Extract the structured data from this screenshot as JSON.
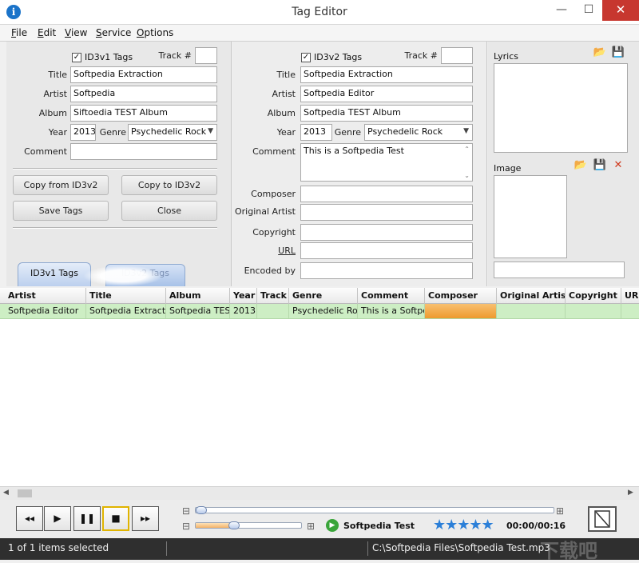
{
  "window": {
    "title": "Tag Editor",
    "minimize": "—",
    "maximize": "☐",
    "close": "✕"
  },
  "menu": [
    "File",
    "Edit",
    "View",
    "Service",
    "Options"
  ],
  "id3v1": {
    "checkbox_label": "ID3v1 Tags",
    "checked": "✓",
    "track_label": "Track #",
    "track_value": "",
    "title_label": "Title",
    "title_value": "Softpedia Extraction",
    "artist_label": "Artist",
    "artist_value": "Softpedia",
    "album_label": "Album",
    "album_value": "Siftoedia TEST Album",
    "year_label": "Year",
    "year_value": "2013",
    "genre_label": "Genre",
    "genre_value": "Psychedelic Rock",
    "comment_label": "Comment",
    "comment_value": "",
    "copy_from_label": "Copy from ID3v2",
    "copy_to_label": "Copy to ID3v2",
    "save_label": "Save Tags",
    "close_label": "Close"
  },
  "tabs": {
    "active": "ID3v1 Tags",
    "inactive": "ID3v2 Tags"
  },
  "id3v2": {
    "checkbox_label": "ID3v2 Tags",
    "checked": "✓",
    "track_label": "Track #",
    "track_value": "",
    "title_label": "Title",
    "title_value": "Softpedia Extraction",
    "artist_label": "Artist",
    "artist_value": "Softpedia Editor",
    "album_label": "Album",
    "album_value": "Softpedia TEST Album",
    "year_label": "Year",
    "year_value": "2013",
    "genre_label": "Genre",
    "genre_value": "Psychedelic Rock",
    "comment_label": "Comment",
    "comment_value": "This is a Softpedia Test",
    "composer_label": "Composer",
    "composer_value": "",
    "original_artist_label": "Original Artist",
    "original_artist_value": "",
    "copyright_label": "Copyright",
    "copyright_value": "",
    "url_label": "URL",
    "url_value": "",
    "encoded_by_label": "Encoded by",
    "encoded_by_value": ""
  },
  "side": {
    "lyrics_label": "Lyrics",
    "image_label": "Image",
    "image_caption": ""
  },
  "grid": {
    "columns": [
      "Artist",
      "Title",
      "Album",
      "Year",
      "Track",
      "Genre",
      "Comment",
      "Composer",
      "Original Artist",
      "Copyright",
      "URL"
    ],
    "rows": [
      [
        "Softpedia Editor",
        "Softpedia Extraction",
        "Softpedia TEST",
        "2013",
        "",
        "Psychedelic Rock",
        "This is a Softpedia Test",
        "",
        "",
        "",
        ""
      ]
    ]
  },
  "player": {
    "prev": "◂◂",
    "play": "▶",
    "pause": "❚❚",
    "stop": "■",
    "next": "▸▸",
    "track_name": "Softpedia Test",
    "time": "00:00/00:16",
    "rating": 5,
    "stars": "★★★★★",
    "position_fraction": 0.0,
    "volume_fraction": 0.35
  },
  "status": {
    "selection": "1 of 1 items selected",
    "file_path": "C:\\Softpedia Files\\Softpedia Test.mp3",
    "watermark": "下载吧"
  },
  "colors": {
    "selected_row": "#cdeec4",
    "composer_highlight": "#f4a640",
    "accent": "#1a73c9"
  }
}
